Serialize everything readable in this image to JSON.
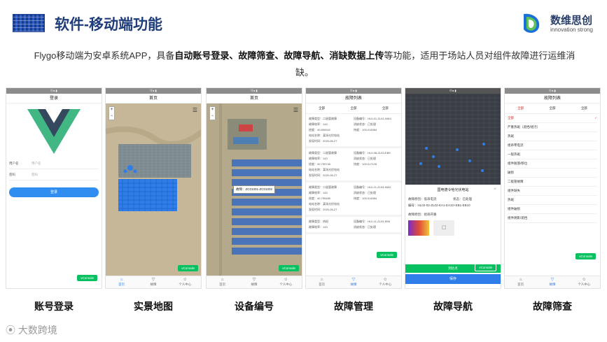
{
  "header": {
    "title": "软件-移动端功能",
    "brand_name": "数维思创",
    "brand_slogan": "innovation strong"
  },
  "intro": {
    "pre": "Flygo移动端为安卓系统APP，具备",
    "bold": "自动账号登录、故障筛查、故障导航、消缺数据上传",
    "post": "等功能，适用于场站人员对组件故障进行运维消缺。"
  },
  "screens": [
    {
      "caption": "账号登录",
      "nav_title": "登录",
      "username_label": "用户名",
      "username_placeholder": "用户名",
      "password_label": "密码",
      "password_placeholder": "密码",
      "login_button": "登录",
      "vconsole": "vConsole"
    },
    {
      "caption": "实景地图",
      "nav_title": "首页",
      "vconsole": "vConsole"
    },
    {
      "caption": "设备编号",
      "nav_title": "首页",
      "tooltip": "故障：ZC01001-ZC01002",
      "vconsole": "vConsole"
    },
    {
      "caption": "故障管理",
      "nav_title": "故障列表",
      "filters": [
        "全部",
        "全部",
        "全部"
      ],
      "cards": [
        {
          "type": "故障类型：二极管故障",
          "code": "设备编号：HL0-01-ZL01-NW4",
          "eff": "故障效率：143",
          "status": "消缺状态：已处理",
          "lon": "经度：40.890942",
          "lat": "纬度：109.014584",
          "station": "电站名称：某场光伏电站",
          "date": "发现时间：2020-06-27"
        },
        {
          "type": "故障类型：二极管故障",
          "code": "设备编号：HL0-08-ZL03-EB9",
          "eff": "故障效率：143",
          "status": "消缺状态：已处理",
          "lon": "经度：40.759746",
          "lat": "纬度：109.017128",
          "station": "电站名称：某场光伏电站",
          "date": "发现时间：2020-06-27"
        },
        {
          "type": "故障类型：二极管故障",
          "code": "设备编号：HL0-11-ZL03-NW2",
          "eff": "故障效率：143",
          "status": "消缺状态：已处理",
          "lon": "经度：40.799485",
          "lat": "纬度：109.014584",
          "station": "电站名称：某场光伏电站",
          "date": "发现时间：2020-06-27"
        },
        {
          "type": "故障类型：热斑",
          "code": "设备编号：HL0-11-ZL03-EB9",
          "eff": "故障效率：143",
          "status": "消缺状态：已处理",
          "lon": "",
          "lat": "",
          "station": "",
          "date": ""
        }
      ],
      "vconsole": "vConsole"
    },
    {
      "caption": "故障导航",
      "popup_title": "国电德令哈光伏电站",
      "fault_reason": "故障原因：低串电流",
      "state": "状态：已处理",
      "code": "编号：HL02-02-ZL02-EA1-EA10+EB1-EB10",
      "image_label": "故障原因：组串开路",
      "save_button": "保存",
      "confirm_button": "到达点",
      "vconsole": "vConsole"
    },
    {
      "caption": "故障筛查",
      "nav_title": "故障列表",
      "filters": [
        "全部",
        "全部",
        "全部"
      ],
      "options": [
        "全部",
        "严重热斑（遮挡/组污）",
        "热斑",
        "组串零电流",
        "一般热斑",
        "组件脱落/移位",
        "破损",
        "二极管故障",
        "组件缺失",
        "热斑",
        "组件破损",
        "组件阴影/遮挡"
      ],
      "vconsole": "vConsole"
    }
  ],
  "tabs": [
    "首页",
    "故障",
    "个人中心"
  ],
  "footer": "大数跨境"
}
